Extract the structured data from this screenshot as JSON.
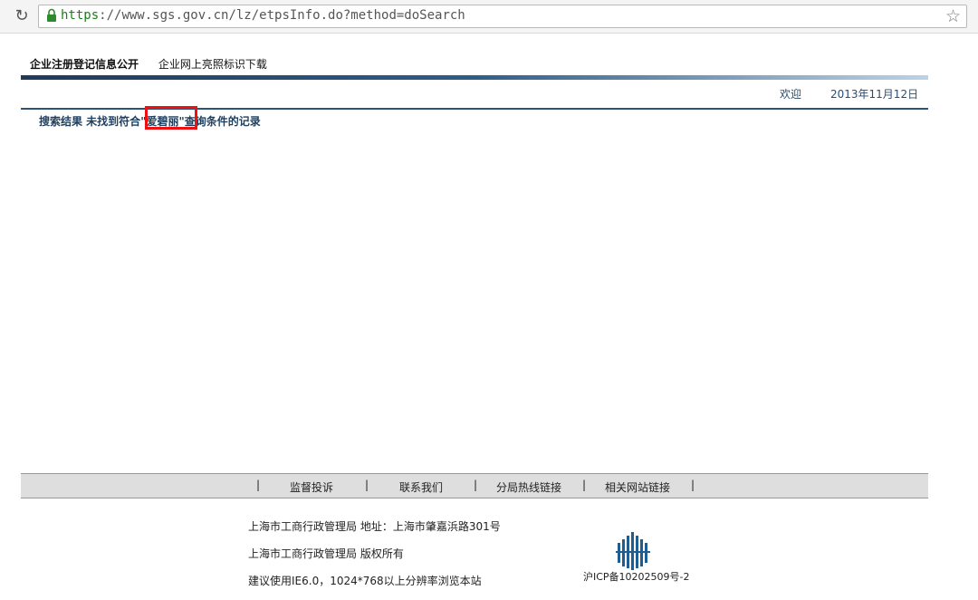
{
  "browser": {
    "url_protocol": "https",
    "url_rest": "://www.sgs.gov.cn/lz/etpsInfo.do?method=doSearch"
  },
  "nav": {
    "tab1": "企业注册登记信息公开",
    "tab2": "企业网上亮照标识下载"
  },
  "header": {
    "welcome": "欢迎",
    "date": "2013年11月12日"
  },
  "result": {
    "prefix": "搜索结果 未找到符合",
    "term": "\"爱碧丽\"",
    "suffix": "查询条件的记录"
  },
  "footer": {
    "sep": "|",
    "link1": "监督投诉",
    "link2": "联系我们",
    "link3": "分局热线链接",
    "link4": "相关网站链接",
    "address": "上海市工商行政管理局 地址：上海市肇嘉浜路301号",
    "copyright": "上海市工商行政管理局 版权所有",
    "advice": "建议使用IE6.0，1024*768以上分辨率浏览本站",
    "icp": "沪ICP备10202509号-2"
  },
  "colors": {
    "highlight": "#e11111",
    "nav_dark": "#1f3a5a"
  },
  "icons": [
    "reload-icon",
    "lock-icon",
    "bookmark-star-icon",
    "gov-logo-icon"
  ]
}
